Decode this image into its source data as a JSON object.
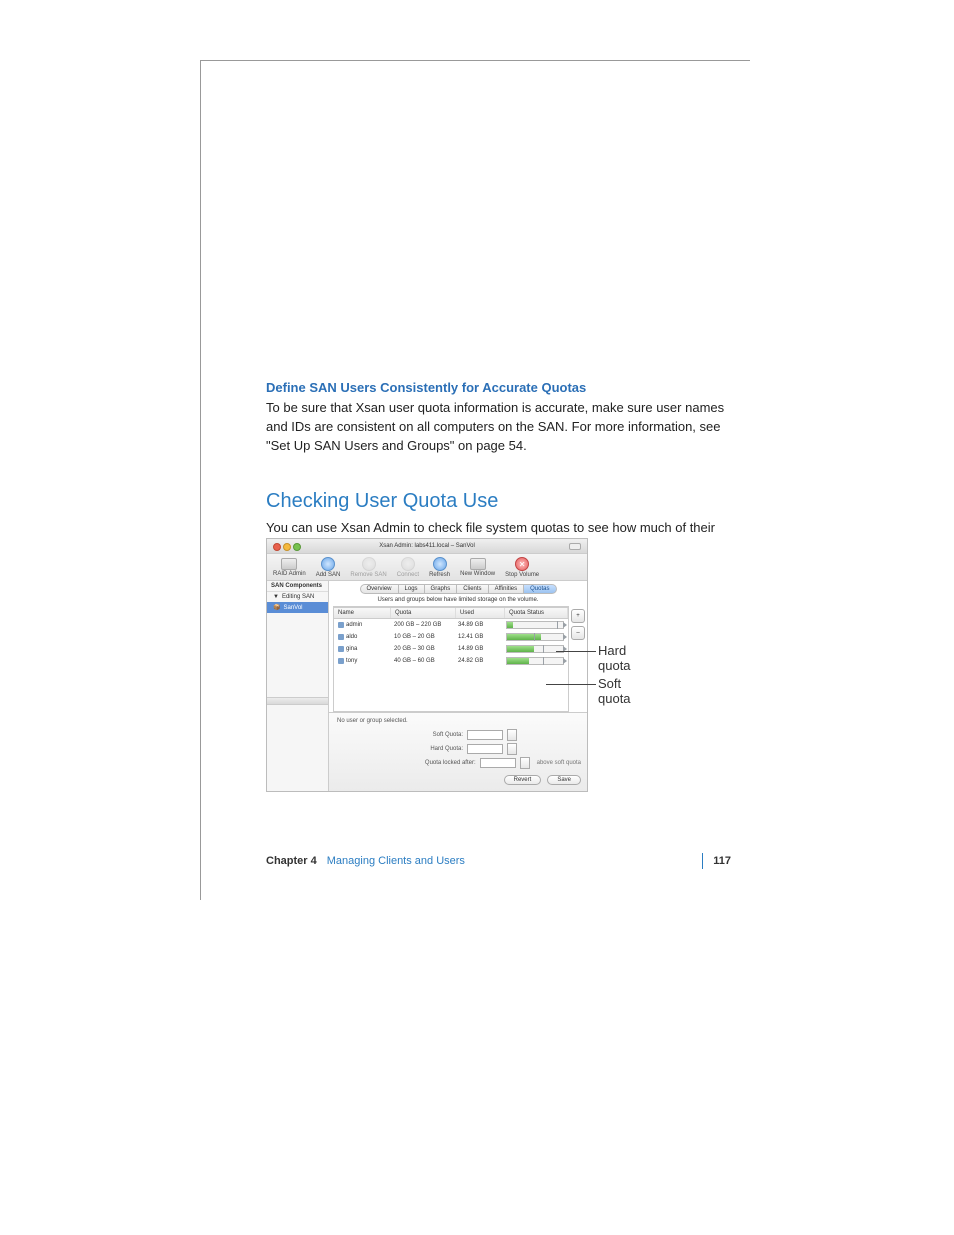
{
  "section1": {
    "heading": "Define SAN Users Consistently for Accurate Quotas",
    "body": "To be sure that Xsan user quota information is accurate, make sure user names and IDs are consistent on all computers on the SAN. For more information, see \"Set Up SAN Users and Groups\" on page 54."
  },
  "section2": {
    "heading": "Checking User Quota Use",
    "body": "You can use Xsan Admin to check file system quotas to see how much of their allotment users and groups are using."
  },
  "window": {
    "title": "Xsan Admin: labs411.local – SanVol",
    "toolbar": [
      {
        "label": "RAID Admin",
        "type": "hw"
      },
      {
        "label": "Add SAN",
        "type": "blue"
      },
      {
        "label": "Remove SAN",
        "type": "grey",
        "disabled": true
      },
      {
        "label": "Connect",
        "type": "grey",
        "disabled": true
      },
      {
        "label": "Refresh",
        "type": "blue"
      },
      {
        "label": "New Window",
        "type": "hw"
      },
      {
        "label": "Stop Volume",
        "type": "red"
      }
    ],
    "sidebar": {
      "header": "SAN Components",
      "group": "Editing SAN",
      "selected": "SanVol"
    },
    "tabs": [
      "Overview",
      "Logs",
      "Graphs",
      "Clients",
      "Affinities",
      "Quotas"
    ],
    "active_tab": "Quotas",
    "note": "Users and groups below have limited storage on the volume.",
    "columns": [
      "Name",
      "Quota",
      "Used",
      "Quota Status"
    ],
    "rows": [
      {
        "name": "admin",
        "quota": "200 GB – 220 GB",
        "used": "34.89 GB",
        "fill": 10,
        "soft": 90
      },
      {
        "name": "aldo",
        "quota": "10 GB – 20 GB",
        "used": "12.41 GB",
        "fill": 60,
        "soft": 48
      },
      {
        "name": "gina",
        "quota": "20 GB – 30 GB",
        "used": "14.89 GB",
        "fill": 48,
        "soft": 65
      },
      {
        "name": "tony",
        "quota": "40 GB – 60 GB",
        "used": "24.82 GB",
        "fill": 40,
        "soft": 65
      }
    ],
    "selection_msg": "No user or group selected.",
    "form": {
      "soft": "Soft Quota:",
      "hard": "Hard Quota:",
      "lock": "Quota locked after:",
      "after": "above soft quota"
    },
    "buttons": {
      "revert": "Revert",
      "save": "Save"
    },
    "add": "+",
    "remove": "–"
  },
  "callouts": {
    "hard": "Hard quota",
    "soft": "Soft quota"
  },
  "runner": {
    "chapter": "Chapter 4",
    "title": "Managing Clients and Users",
    "page": "117"
  }
}
